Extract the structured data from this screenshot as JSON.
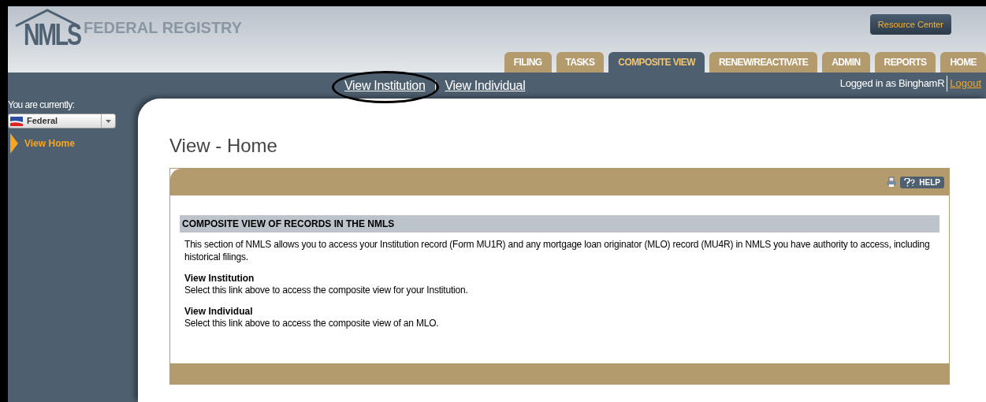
{
  "header": {
    "logo": "NMLS",
    "title": "FEDERAL REGISTRY",
    "resource_button": "Resource Center"
  },
  "tabs": [
    {
      "label": "FILING",
      "selected": false
    },
    {
      "label": "TASKS",
      "selected": false
    },
    {
      "label": "COMPOSITE VIEW",
      "selected": true
    },
    {
      "label": "RENEW/REACTIVATE",
      "selected": false
    },
    {
      "label": "ADMIN",
      "selected": false
    },
    {
      "label": "REPORTS",
      "selected": false
    },
    {
      "label": "HOME",
      "selected": false
    }
  ],
  "nav_links": [
    {
      "label": "View Institution",
      "circled": true
    },
    {
      "label": "View Individual",
      "circled": false
    }
  ],
  "user": {
    "logged_in": "Logged in as BinghamR",
    "logout": "Logout"
  },
  "sidebar": {
    "label": "You are currently:",
    "select": "Federal",
    "items": [
      {
        "label": "View Home",
        "selected": true
      }
    ]
  },
  "page_title": "View - Home",
  "panel": {
    "help": "HELP",
    "section_heading": "COMPOSITE VIEW OF RECORDS IN THE NMLS",
    "intro": "This section of NMLS allows you to access your Institution record (Form MU1R) and any mortgage loan originator (MLO) record (MU4R) in NMLS you have authority to access, including historical filings.",
    "entries": [
      {
        "title": "View Institution",
        "text": "Select this link above to access the composite view for your Institution."
      },
      {
        "title": "View Individual",
        "text": "Select this link above to access the composite view of an MLO."
      }
    ]
  }
}
